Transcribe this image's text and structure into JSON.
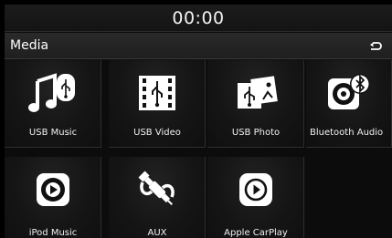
{
  "status_bar": {
    "clock": "00:00"
  },
  "header": {
    "title": "Media",
    "back_icon": "back-arrow-icon"
  },
  "tiles": [
    {
      "label": "USB Music",
      "icon": "usb-music-icon"
    },
    {
      "label": "USB Video",
      "icon": "usb-video-icon"
    },
    {
      "label": "USB Photo",
      "icon": "usb-photo-icon"
    },
    {
      "label": "Bluetooth Audio",
      "icon": "bluetooth-audio-icon"
    },
    {
      "label": "iPod Music",
      "icon": "ipod-icon"
    },
    {
      "label": "AUX",
      "icon": "aux-cable-icon"
    },
    {
      "label": "Apple CarPlay",
      "icon": "carplay-icon"
    }
  ],
  "colors": {
    "background": "#0c0c0c",
    "tile": "#151515",
    "text": "#ffffff"
  }
}
